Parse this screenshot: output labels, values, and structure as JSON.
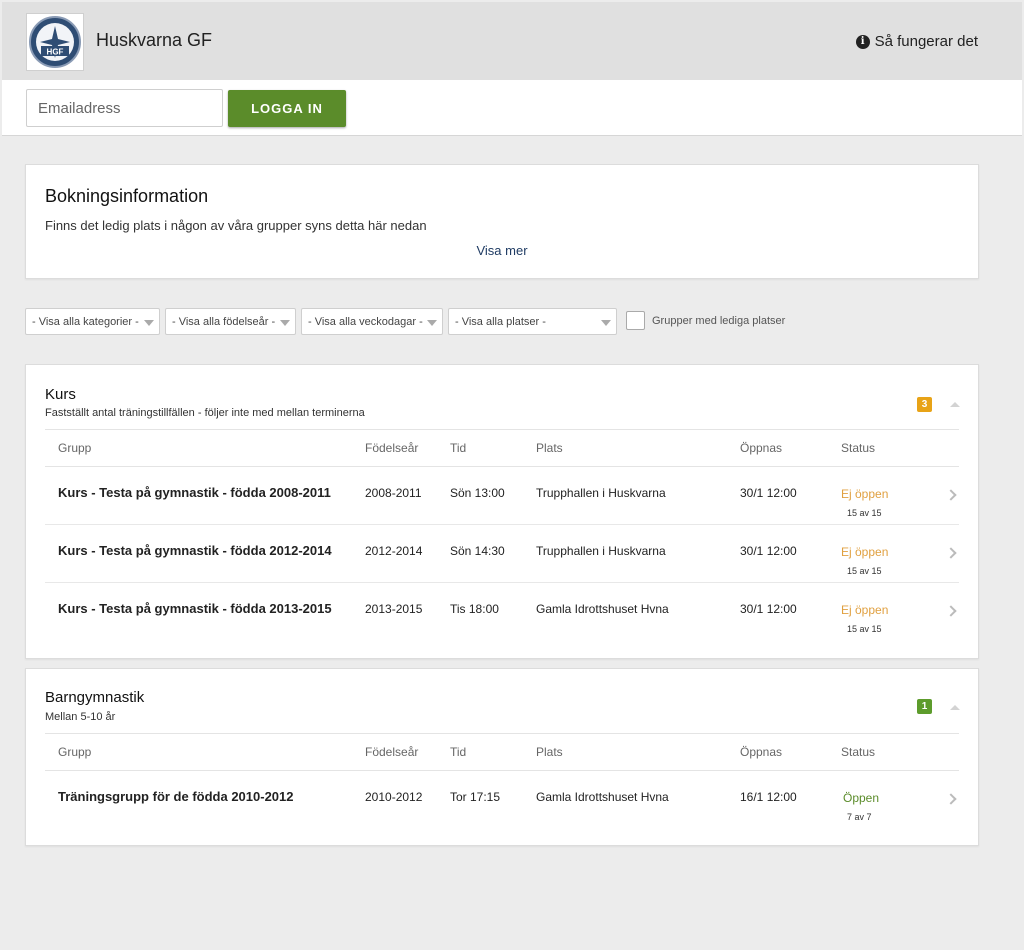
{
  "header": {
    "org_name": "Huskvarna GF",
    "logo_text": "HGF",
    "help_label": "Så fungerar det"
  },
  "login": {
    "email_placeholder": "Emailadress",
    "login_button": "LOGGA IN"
  },
  "info": {
    "title": "Bokningsinformation",
    "text": "Finns det ledig plats i någon av våra grupper syns detta här nedan",
    "more_link": "Visa mer"
  },
  "filters": {
    "category": "- Visa alla kategorier -",
    "birth_year": "- Visa alla födelseår -",
    "weekday": "- Visa alla veckodagar -",
    "place": "- Visa alla platser -",
    "free_spots_label": "Grupper med lediga platser"
  },
  "columns": {
    "group": "Grupp",
    "birth_year": "Födelseår",
    "time": "Tid",
    "place": "Plats",
    "opens": "Öppnas",
    "status": "Status"
  },
  "colors": {
    "accent_green": "#5b8c2a",
    "status_closed": "#e0a040",
    "status_open": "#5b8c2a",
    "badge_orange": "#e8a317",
    "badge_green": "#5d9c2c"
  },
  "sections": [
    {
      "title": "Kurs",
      "subtitle": "Fastställt antal träningstillfällen - följer inte med mellan terminerna",
      "count": "3",
      "rows": [
        {
          "name": "Kurs - Testa på gymnastik - födda 2008-2011",
          "birth": "2008-2011",
          "time": "Sön 13:00",
          "place": "Trupphallen i Huskvarna",
          "opens": "30/1 12:00",
          "status": "Ej öppen",
          "avail": "15 av 15"
        },
        {
          "name": "Kurs - Testa på gymnastik - födda 2012-2014",
          "birth": "2012-2014",
          "time": "Sön 14:30",
          "place": "Trupphallen i Huskvarna",
          "opens": "30/1 12:00",
          "status": "Ej öppen",
          "avail": "15 av 15"
        },
        {
          "name": "Kurs - Testa på gymnastik - födda 2013-2015",
          "birth": "2013-2015",
          "time": "Tis 18:00",
          "place": "Gamla Idrottshuset Hvna",
          "opens": "30/1 12:00",
          "status": "Ej öppen",
          "avail": "15 av 15"
        }
      ]
    },
    {
      "title": "Barngymnastik",
      "subtitle": "Mellan 5-10 år",
      "count": "1",
      "rows": [
        {
          "name": "Träningsgrupp för de födda 2010-2012",
          "birth": "2010-2012",
          "time": "Tor 17:15",
          "place": "Gamla Idrottshuset Hvna",
          "opens": "16/1 12:00",
          "status": "Öppen",
          "avail": "7 av 7"
        }
      ]
    }
  ]
}
